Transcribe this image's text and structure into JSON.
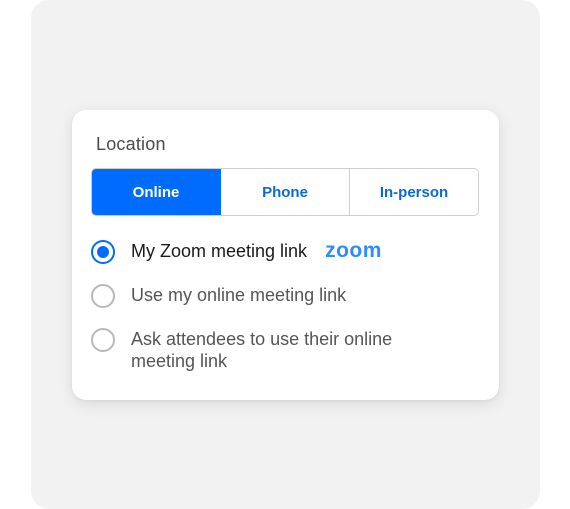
{
  "location": {
    "title": "Location",
    "tabs": [
      {
        "label": "Online",
        "active": true
      },
      {
        "label": "Phone",
        "active": false
      },
      {
        "label": "In-person",
        "active": false
      }
    ],
    "options": [
      {
        "label": "My Zoom meeting link",
        "selected": true,
        "logo": "zoom"
      },
      {
        "label": "Use my online meeting link",
        "selected": false
      },
      {
        "label": "Ask attendees to use their online meeting link",
        "selected": false
      }
    ]
  },
  "colors": {
    "accent": "#006bff",
    "zoom_brand": "#2d8cff",
    "background": "#f2f2f2"
  }
}
